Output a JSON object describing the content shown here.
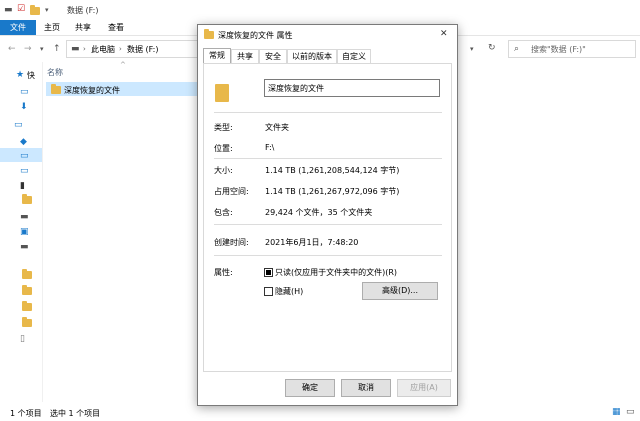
{
  "explorer": {
    "title": "数据 (F:)",
    "ribbon_tabs": [
      "文件",
      "主页",
      "共享",
      "查看"
    ],
    "breadcrumb": [
      "此电脑",
      "数据 (F:)"
    ],
    "search_placeholder": "搜索\"数据 (F:)\"",
    "column_header": "名称",
    "folder_name": "深度恢复的文件",
    "sidebar_labels": [
      "快"
    ],
    "status_left": "1 个项目",
    "status_selected": "选中 1 个项目"
  },
  "dialog": {
    "title": "深度恢复的文件 属性",
    "tabs": [
      "常规",
      "共享",
      "安全",
      "以前的版本",
      "自定义"
    ],
    "name_value": "深度恢复的文件",
    "rows": {
      "type_label": "类型:",
      "type_value": "文件夹",
      "location_label": "位置:",
      "location_value": "F:\\",
      "size_label": "大小:",
      "size_value": "1.14 TB (1,261,208,544,124 字节)",
      "disk_label": "占用空间:",
      "disk_value": "1.14 TB (1,261,267,972,096 字节)",
      "contains_label": "包含:",
      "contains_value": "29,424 个文件，35 个文件夹",
      "created_label": "创建时间:",
      "created_value": "2021年6月1日，7:48:20",
      "attributes_label": "属性:"
    },
    "readonly_label": "只读(仅应用于文件夹中的文件)(R)",
    "hidden_label": "隐藏(H)",
    "advanced_button": "高级(D)...",
    "ok_button": "确定",
    "cancel_button": "取消",
    "apply_button": "应用(A)"
  },
  "colors": {
    "accent": "#1979ca",
    "folder": "#e8b84a",
    "selection": "#cce8ff"
  }
}
